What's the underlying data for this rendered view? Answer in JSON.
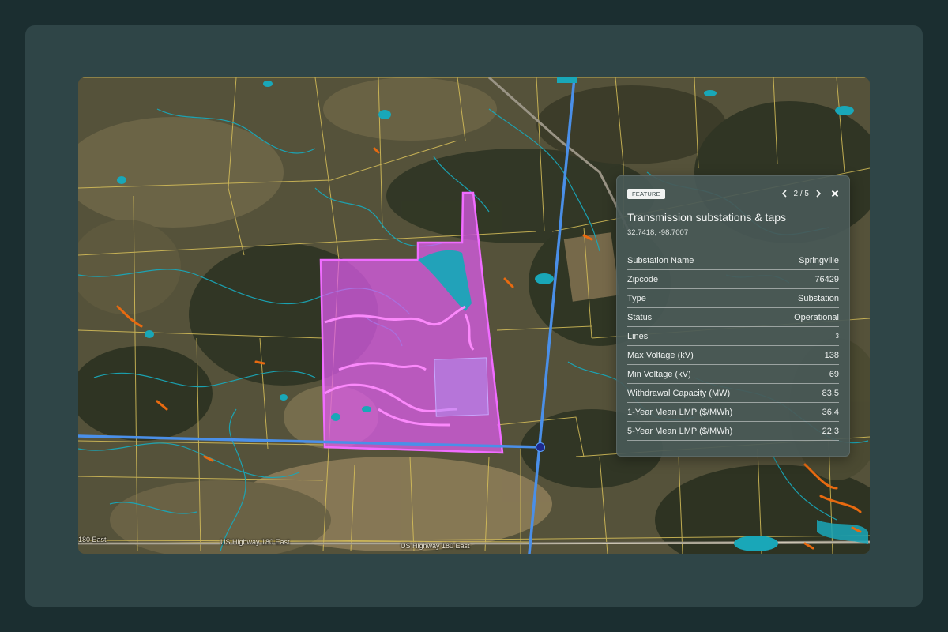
{
  "map": {
    "road_labels": [
      "180 East",
      "US Highway 180 East",
      "US Highway 180 East"
    ]
  },
  "panel": {
    "badge": "FEATURE",
    "pager": "2 / 5",
    "title": "Transmission substations & taps",
    "coords": "32.7418, -98.7007",
    "rows": [
      {
        "label": "Substation Name",
        "value": "Springville"
      },
      {
        "label": "Zipcode",
        "value": "76429"
      },
      {
        "label": "Type",
        "value": "Substation"
      },
      {
        "label": "Status",
        "value": "Operational"
      },
      {
        "label": "Lines",
        "value": "3"
      },
      {
        "label": "Max Voltage (kV)",
        "value": "138"
      },
      {
        "label": "Min Voltage (kV)",
        "value": "69"
      },
      {
        "label": "Withdrawal Capacity (MW)",
        "value": "83.5"
      },
      {
        "label": "1-Year Mean LMP ($/MWh)",
        "value": "36.4"
      },
      {
        "label": "5-Year Mean LMP ($/MWh)",
        "value": "22.3"
      }
    ]
  },
  "colors": {
    "parcel_highlight": "#e05cf0",
    "transmission_line": "#4a8fe8",
    "substation_point": "#1f2a8c",
    "parcel_boundary": "#d9c15a",
    "water": "#19a7b8",
    "wetland": "#e86a10"
  }
}
